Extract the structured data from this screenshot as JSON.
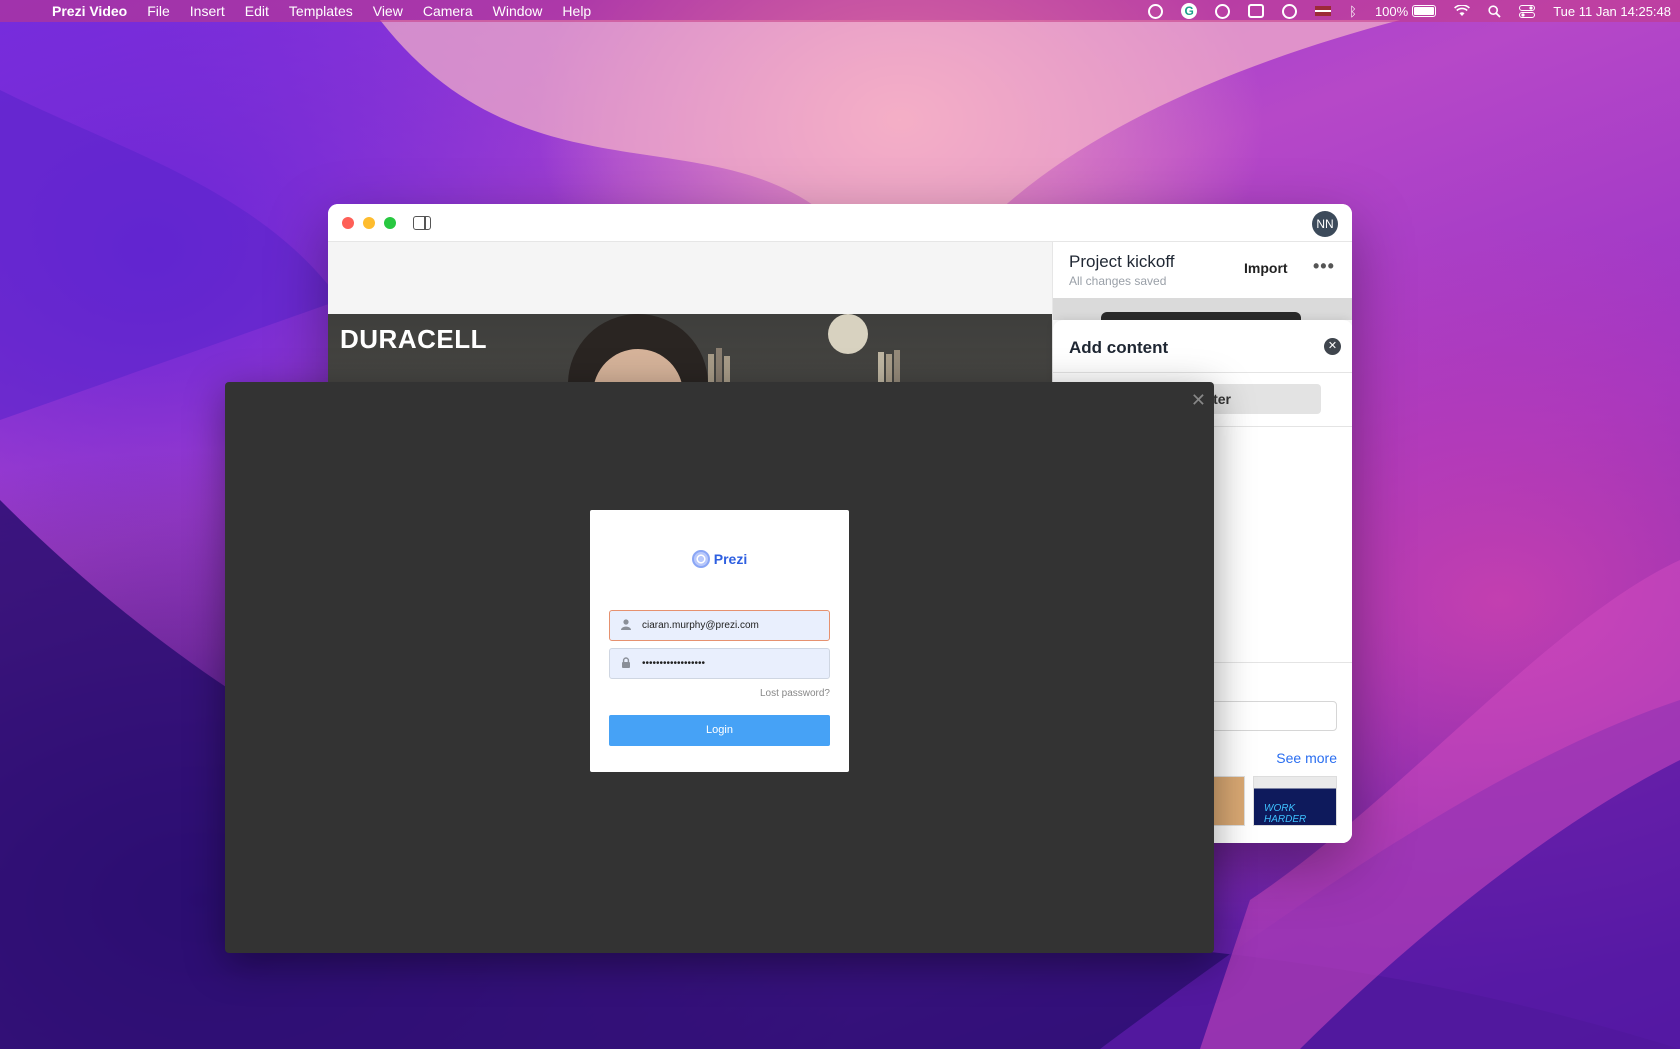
{
  "menubar": {
    "app_name": "Prezi Video",
    "items": [
      "File",
      "Insert",
      "Edit",
      "Templates",
      "View",
      "Camera",
      "Window",
      "Help"
    ],
    "battery": "100%",
    "clock": "Tue 11 Jan  14:25:48"
  },
  "window": {
    "avatar_initials": "NN",
    "brand_overlay": "DURACELL",
    "project_title": "Project kickoff",
    "project_status": "All changes saved",
    "import_label": "Import",
    "more_label": "•••"
  },
  "add_content": {
    "title": "Add content",
    "computer_button": "omputer",
    "see_more": "See more",
    "thumbnail_text": "WORK HARDER"
  },
  "login": {
    "logo_text": "Prezi",
    "email_value": "ciaran.murphy@prezi.com",
    "password_value": "••••••••••••••••••",
    "lost_password": "Lost password?",
    "login_button": "Login",
    "close_label": "✕"
  },
  "colors": {
    "login_button": "#46a2f6",
    "link_blue": "#2a6ef0",
    "modal_bg": "#333333"
  }
}
